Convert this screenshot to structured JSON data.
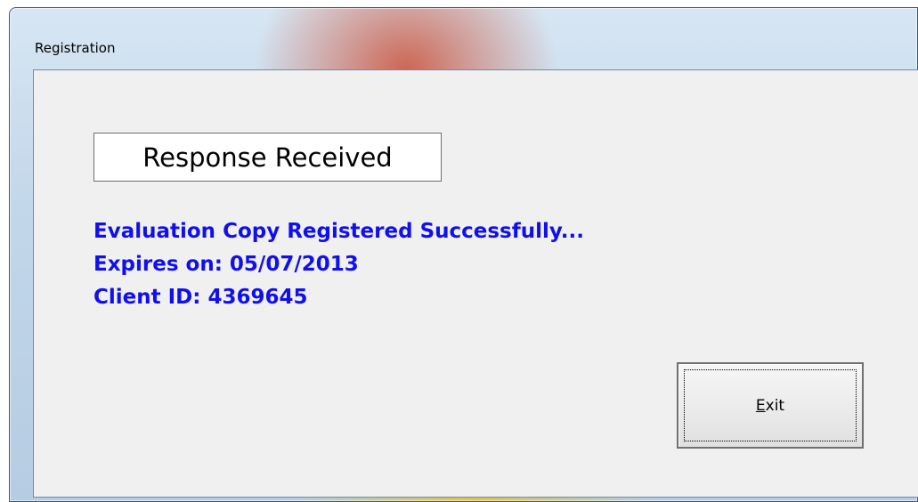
{
  "window": {
    "title": "Registration"
  },
  "response_box": {
    "text": "Response Received"
  },
  "messages": [
    "Evaluation Copy Registered Successfully...",
    "Expires on: 05/07/2013",
    "Client ID: 4369645"
  ],
  "exit_button": {
    "mnemonic": "E",
    "rest": "xit"
  },
  "colors": {
    "message_text": "#1010ee",
    "client_background": "#f0f0f0"
  }
}
